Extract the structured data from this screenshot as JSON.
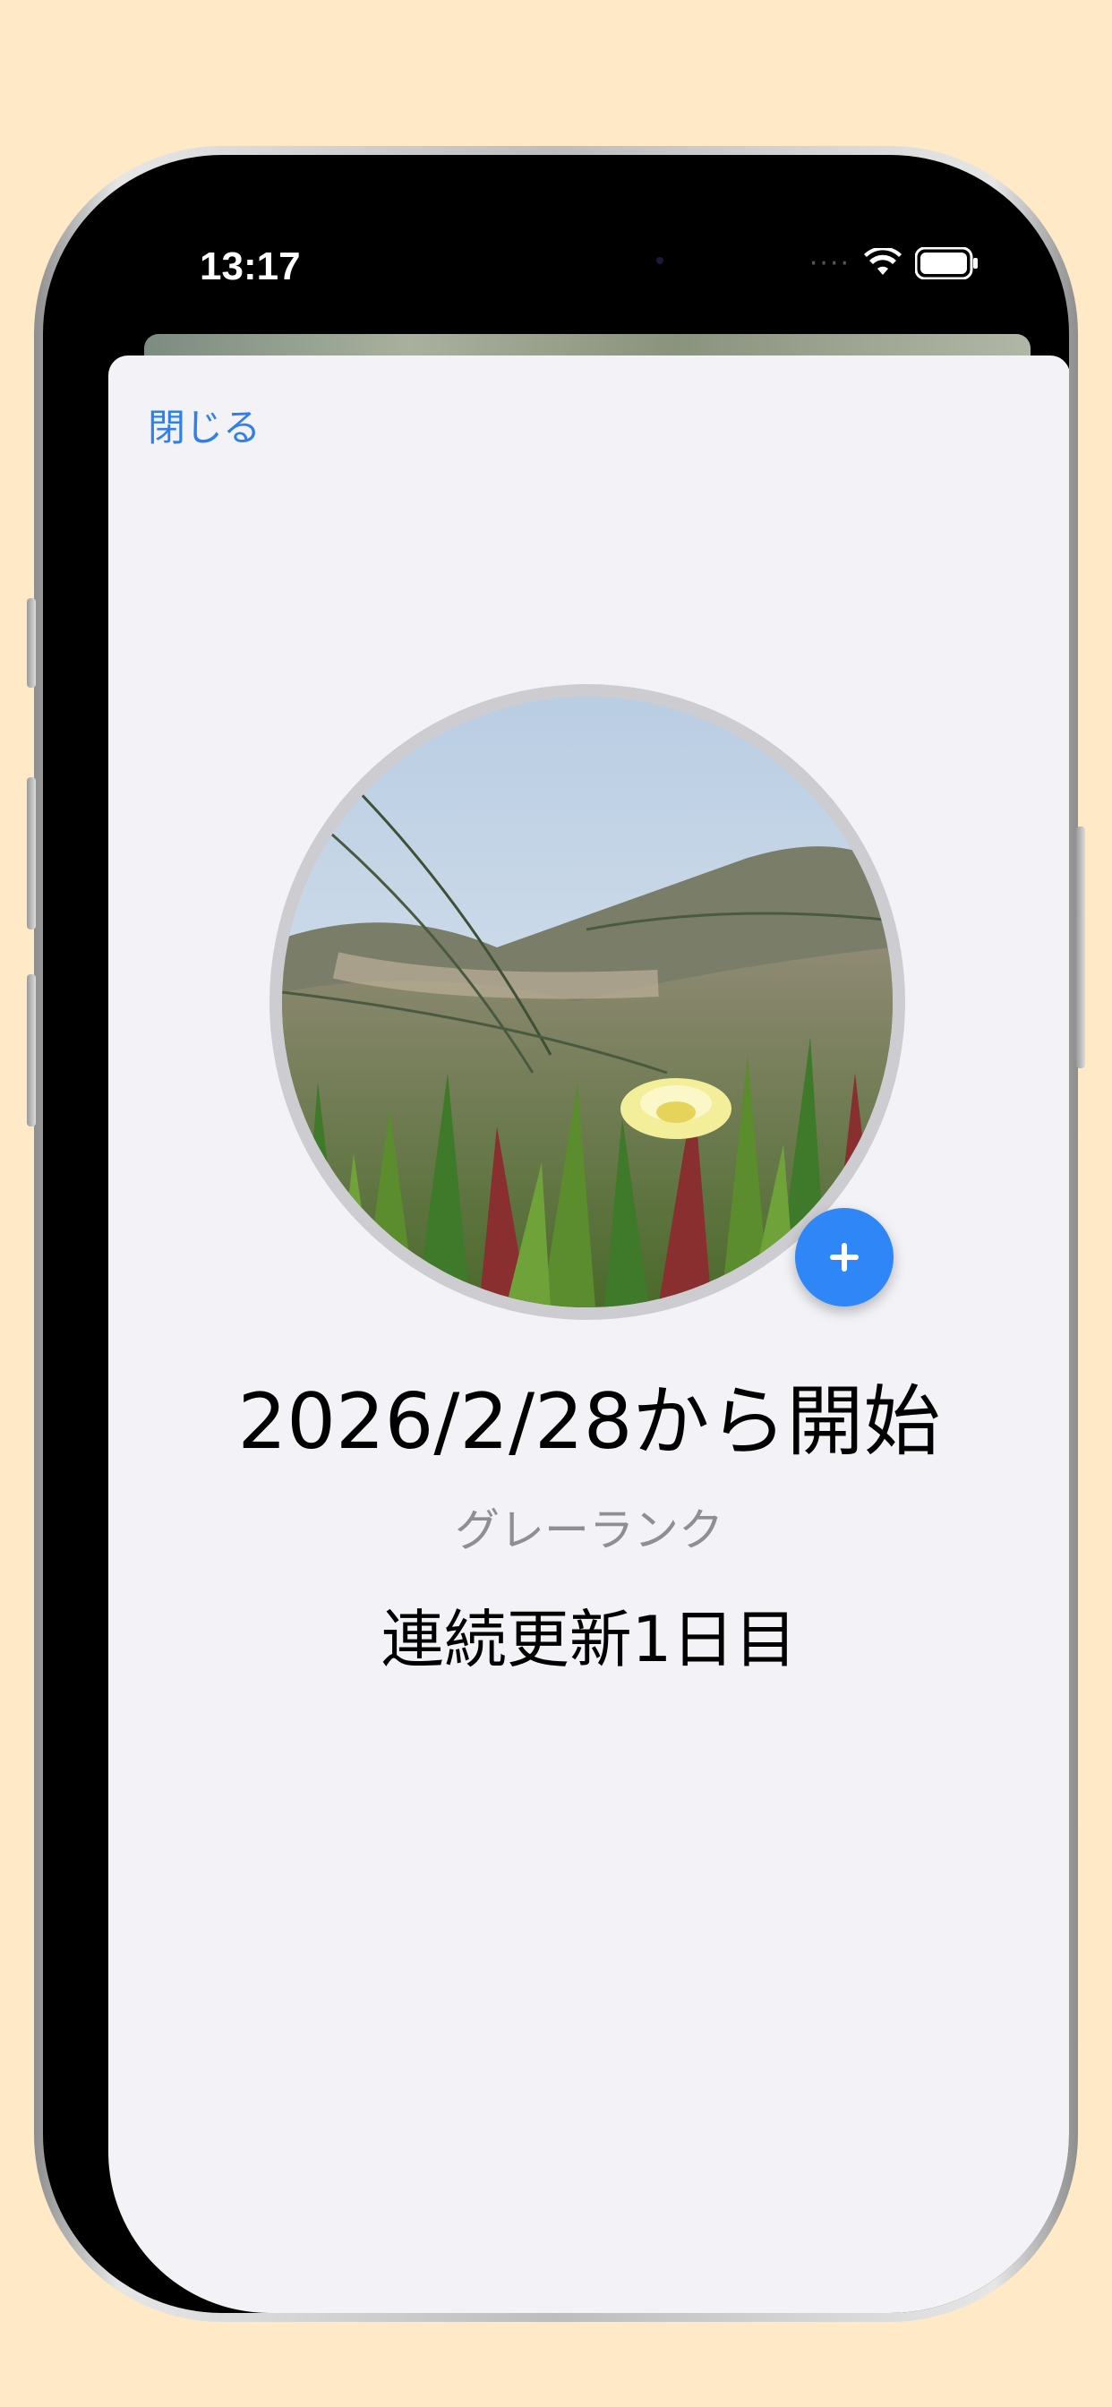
{
  "status_bar": {
    "time": "13:17",
    "icons": [
      "cellular-icon",
      "wifi-icon",
      "battery-icon"
    ]
  },
  "sheet": {
    "close_label": "閉じる",
    "avatar_alt": "flower photo",
    "add_icon": "plus-icon",
    "title": "2026/2/28から開始",
    "rank": "グレーランク",
    "streak": "連続更新1日目"
  },
  "colors": {
    "background": "#FFE9C7",
    "sheet": "#F2F2F7",
    "accent": "#2F80ED",
    "secondary_text": "#8E8E93"
  }
}
